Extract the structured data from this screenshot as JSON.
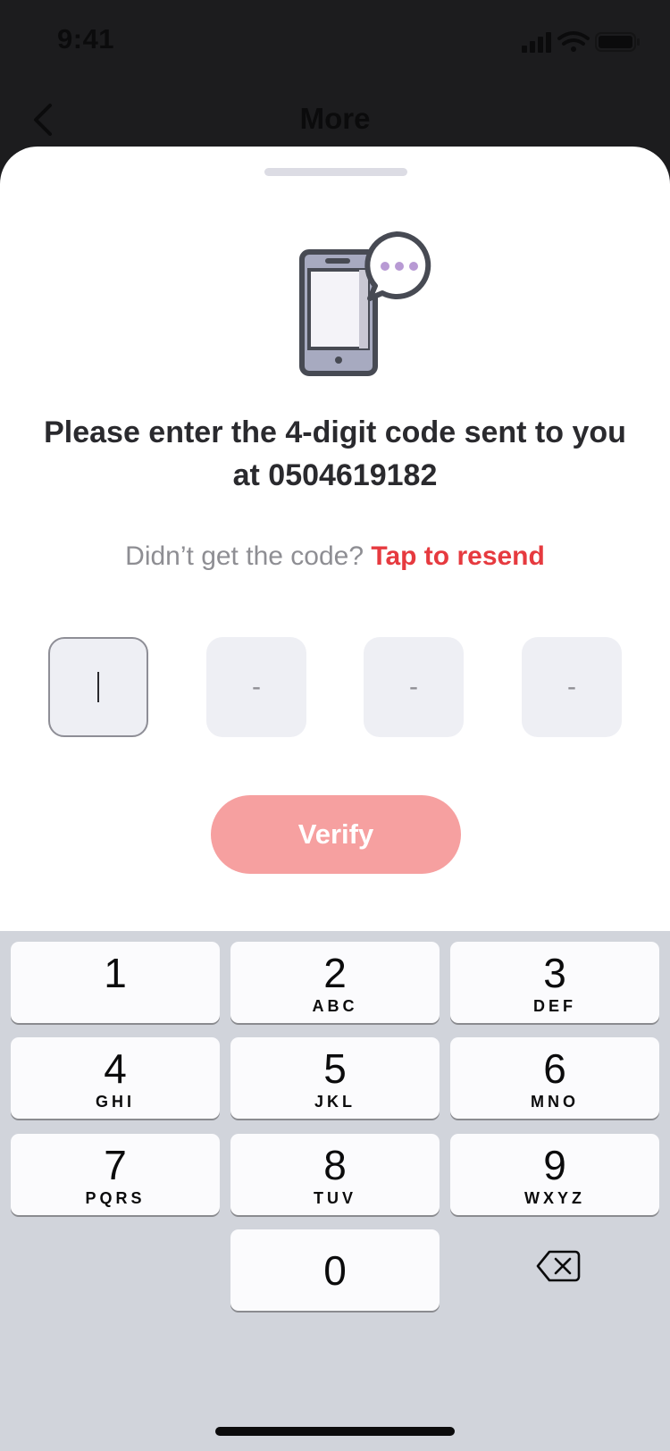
{
  "status_bar": {
    "time": "9:41",
    "icons": [
      "cellular-signal-icon",
      "wifi-icon",
      "battery-icon"
    ]
  },
  "nav": {
    "back_icon": "chevron-left-icon",
    "title": "More"
  },
  "sheet": {
    "illustration_icon": "phone-with-chat-bubble-icon",
    "heading": "Please enter the 4-digit code sent to you at 0504619182",
    "resend_prompt": "Didn’t get the code?",
    "resend_link": "Tap to resend",
    "code_placeholders": [
      "",
      "-",
      "-",
      "-"
    ],
    "verify_label": "Verify"
  },
  "keyboard": {
    "keys": [
      {
        "digit": "1",
        "letters": ""
      },
      {
        "digit": "2",
        "letters": "ABC"
      },
      {
        "digit": "3",
        "letters": "DEF"
      },
      {
        "digit": "4",
        "letters": "GHI"
      },
      {
        "digit": "5",
        "letters": "JKL"
      },
      {
        "digit": "6",
        "letters": "MNO"
      },
      {
        "digit": "7",
        "letters": "PQRS"
      },
      {
        "digit": "8",
        "letters": "TUV"
      },
      {
        "digit": "9",
        "letters": "WXYZ"
      },
      {
        "digit": "0",
        "letters": ""
      }
    ],
    "delete_icon": "backspace-icon"
  },
  "colors": {
    "accent_red": "#e63a3f",
    "verify_disabled": "#f6a0a0",
    "keyboard_bg": "#d1d4db",
    "code_box_bg": "#eeeff4"
  }
}
